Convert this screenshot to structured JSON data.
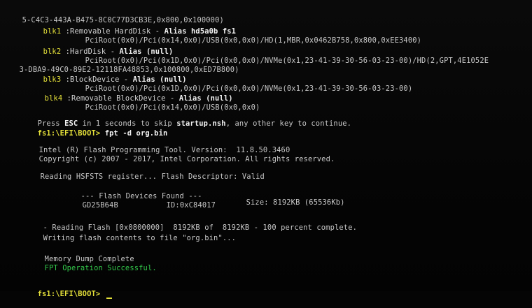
{
  "lines": {
    "l1": "5-C4C3-443A-B475-8C0C77D3CB3E,0x800,0x100000)",
    "blk1": {
      "label": "blk1",
      "desc": " :Removable HardDisk - ",
      "alias": "Alias hd5a0b fs1"
    },
    "blk1_path": "PciRoot(0x0)/Pci(0x14,0x0)/USB(0x0,0x0)/HD(1,MBR,0x0462B758,0x800,0xEE3400)",
    "blk2": {
      "label": "blk2",
      "desc": " :HardDisk - ",
      "alias": "Alias (null)"
    },
    "blk2_path": "PciRoot(0x0)/Pci(0x1D,0x0)/Pci(0x0,0x0)/NVMe(0x1,23-41-39-30-56-03-23-00)/HD(2,GPT,4E1052E",
    "blk2_cont": "3-DBA9-49C0-89E2-12118FA48853,0x100800,0xED7B800)",
    "blk3": {
      "label": "blk3",
      "desc": " :BlockDevice - ",
      "alias": "Alias (null)"
    },
    "blk3_path": "PciRoot(0x0)/Pci(0x1D,0x0)/Pci(0x0,0x0)/NVMe(0x1,23-41-39-30-56-03-23-00)",
    "blk4": {
      "label": "blk4",
      "desc": " :Removable BlockDevice - ",
      "alias": "Alias (null)"
    },
    "blk4_path": "PciRoot(0x0)/Pci(0x14,0x0)/USB(0x0,0x0)",
    "press_pre": "Press ",
    "press_esc": "ESC",
    "press_mid": " in 1 seconds to skip ",
    "press_nsh": "startup.nsh",
    "press_post": ", any other key to continue.",
    "prompt1": "fs1:\\EFI\\BOOT> ",
    "command1": "fpt -d org.bin",
    "tool": "Intel (R) Flash Programming Tool. Version:  11.8.50.3460",
    "copyright": "Copyright (c) 2007 - 2017, Intel Corporation. All rights reserved.",
    "reading_hsf": "Reading HSFSTS register... Flash Descriptor: Valid",
    "devices_header": "--- Flash Devices Found ---",
    "device_name": "GD25B64B",
    "device_id": "ID:0xC84017",
    "device_size": "Size: 8192KB (65536Kb)",
    "reading_flash": "- Reading Flash [0x0800000]  8192KB of  8192KB - 100 percent complete.",
    "writing": "Writing flash contents to file \"org.bin\"...",
    "dump": "Memory Dump Complete",
    "success": "FPT Operation Successful.",
    "prompt2": "fs1:\\EFI\\BOOT> "
  },
  "colors": {
    "prompt": "#e6e23a",
    "success": "#33c94b",
    "text": "#c8c8c8",
    "background": "#050505"
  }
}
